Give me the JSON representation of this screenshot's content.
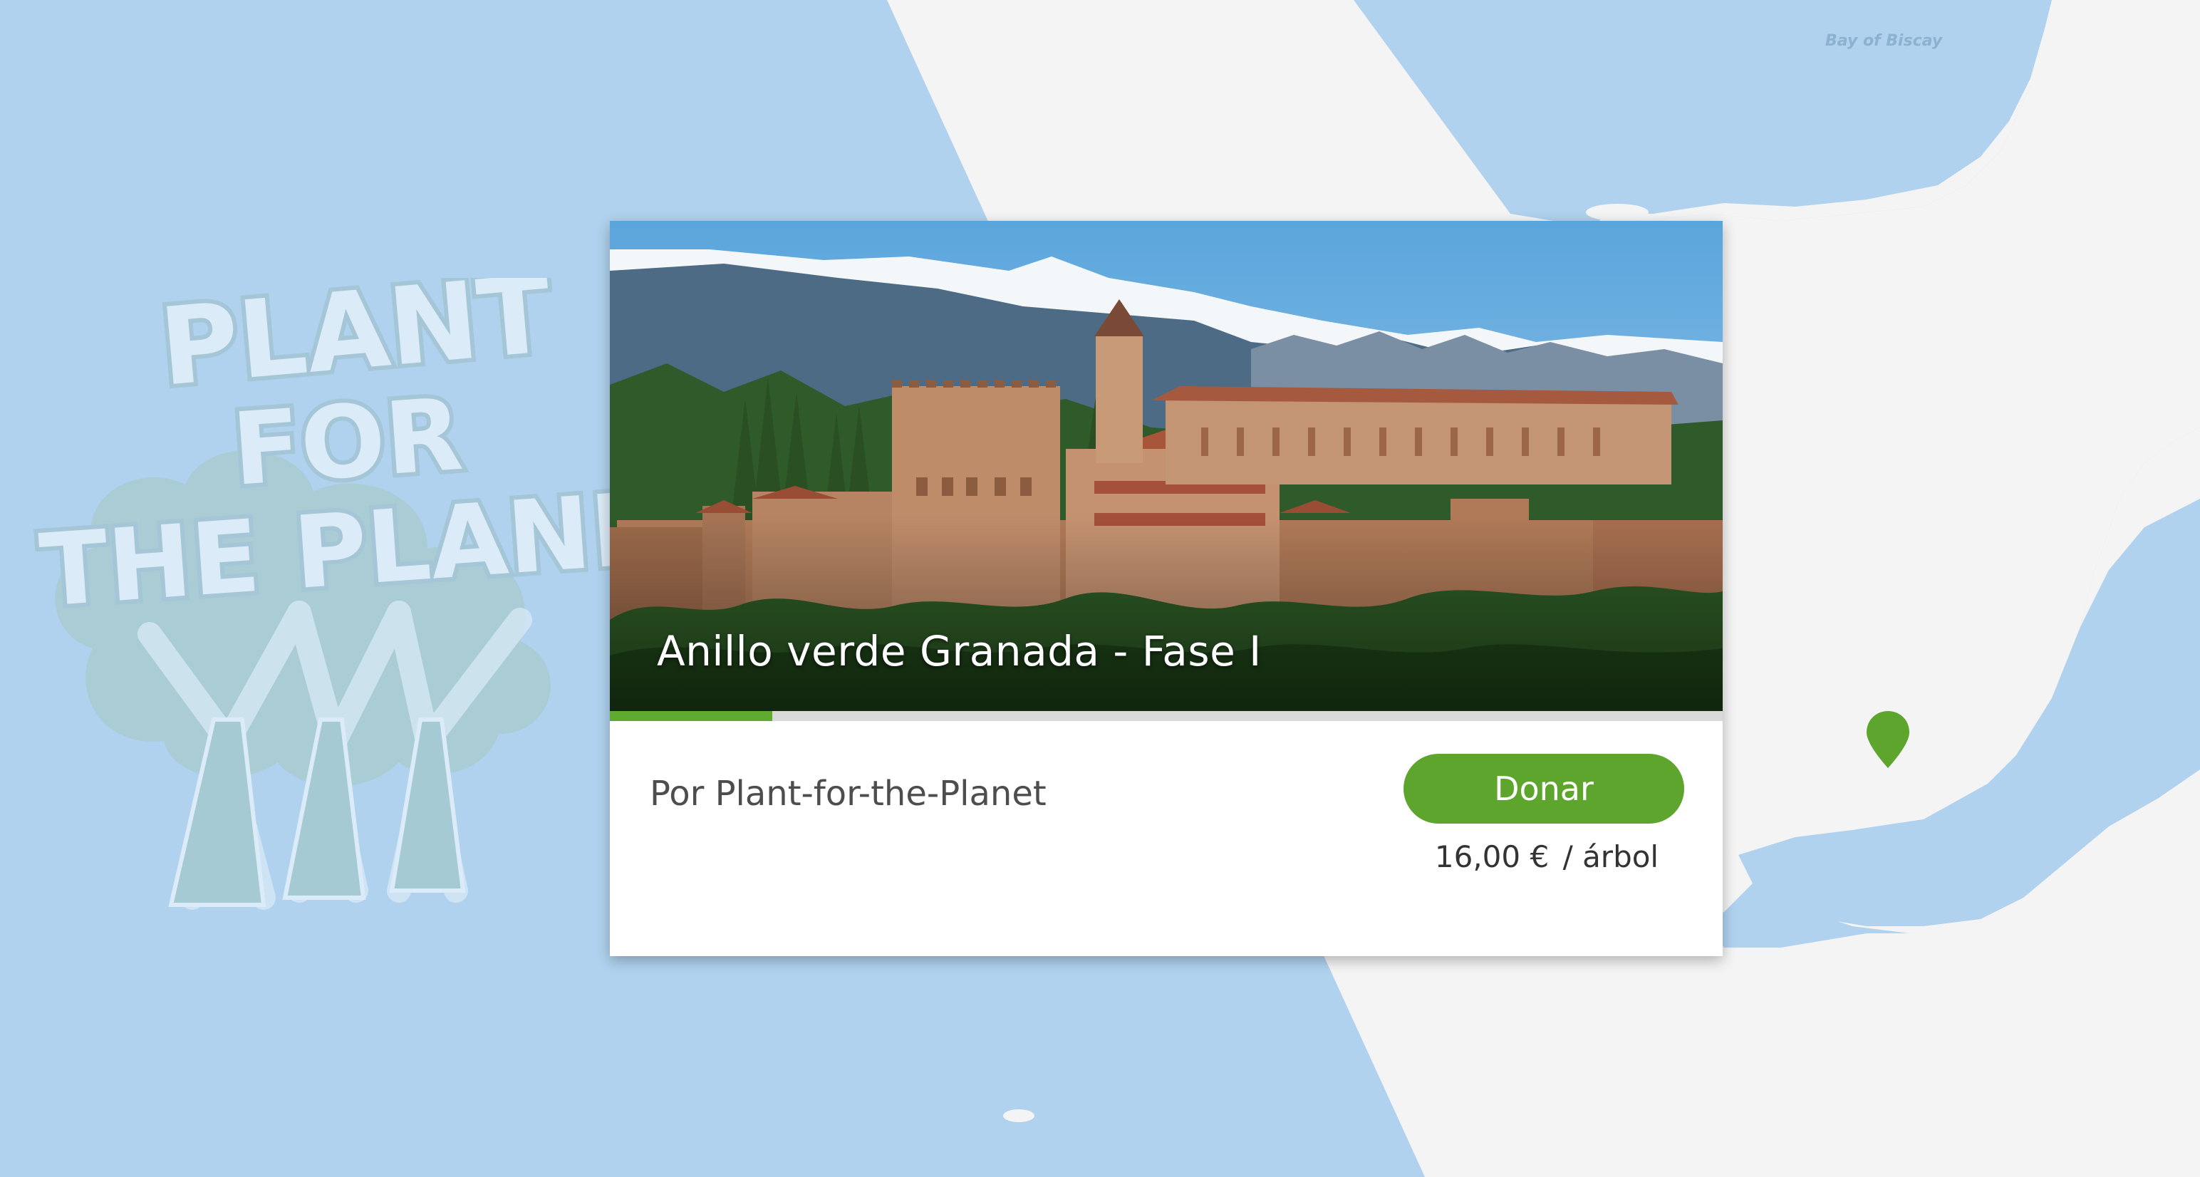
{
  "map": {
    "water_label": "Bay of Biscay",
    "colors": {
      "water": "#b0d2ee",
      "land": "#f4f4f4"
    },
    "marker": {
      "icon": "map-pin-icon",
      "color": "#5ea52e"
    }
  },
  "brand_logo": {
    "text": "PLANT FOR THE PLANET",
    "icon": "plant-for-the-planet-logo"
  },
  "project": {
    "title": "Anillo verde Granada - Fase I",
    "image_icon": "alhambra-photo",
    "owner": "Por Plant-for-the-Planet",
    "progress_percent": 14.6,
    "donate_label": "Donar",
    "price": "16,00 €",
    "price_unit": "/ árbol",
    "colors": {
      "accent": "#5ea52e",
      "progress_track": "#d9d9d9"
    }
  }
}
